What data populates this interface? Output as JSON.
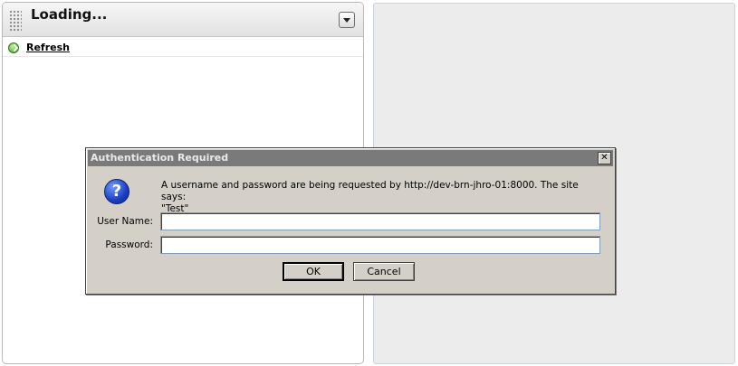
{
  "portlet": {
    "title": "Loading...",
    "refresh_label": "Refresh"
  },
  "dialog": {
    "title": "Authentication Required",
    "close_label": "✕",
    "message_line1": "A username and password are being requested by http://dev-brn-jhro-01:8000. The site says:",
    "message_line2": "\"Test\"",
    "username_label": "User Name:",
    "username_value": "",
    "password_label": "Password:",
    "password_value": "",
    "ok_label": "OK",
    "cancel_label": "Cancel",
    "icon": "question-icon"
  },
  "colors": {
    "dialog_bg": "#d4d0c8",
    "titlebar_bg": "#7a7a7a",
    "right_panel_bg": "#ececec"
  }
}
